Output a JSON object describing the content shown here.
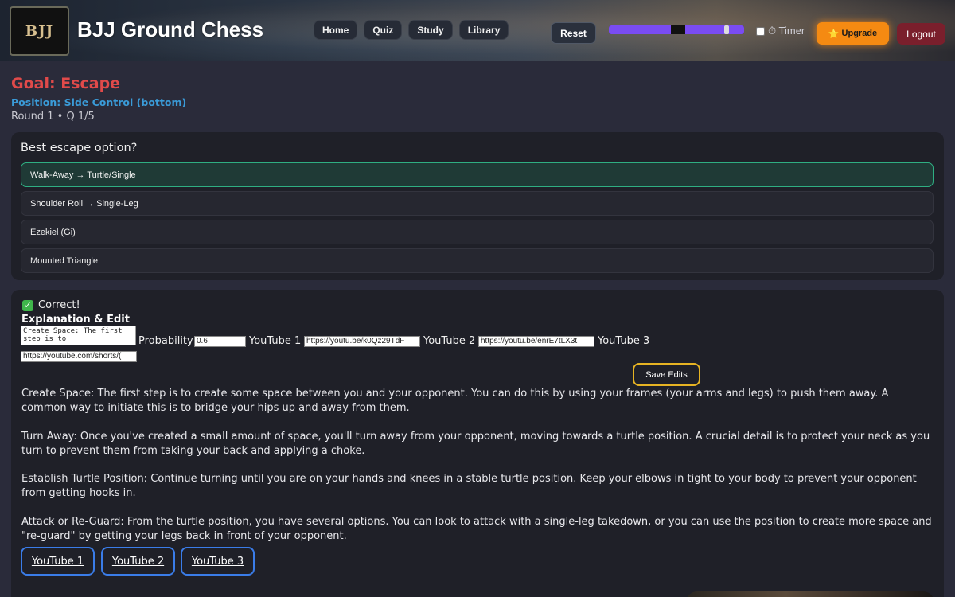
{
  "header": {
    "logo_text": "BJJ",
    "title": "BJJ Ground Chess",
    "nav": [
      "Home",
      "Quiz",
      "Study",
      "Library"
    ],
    "reset_label": "Reset",
    "progress": 0.8,
    "timer_label": "⏱ Timer",
    "timer_checked": false,
    "upgrade_label": "Upgrade",
    "upgrade_icon": "⭐",
    "logout_label": "Logout"
  },
  "quiz": {
    "goal": "Goal: Escape",
    "position": "Position: Side Control (bottom)",
    "round": "Round 1 • Q 1/5",
    "question": "Best escape option?",
    "options": [
      "Walk-Away → Turtle/Single",
      "Shoulder Roll → Single-Leg",
      "Ezekiel (Gi)",
      "Mounted Triangle"
    ],
    "selected_index": 0
  },
  "answer": {
    "status": "Correct!",
    "edit_title": "Explanation & Edit",
    "textarea_value": "Create Space: The first step is to",
    "probability_label": "Probability",
    "probability_value": "0.6",
    "yt1_label": "YouTube 1",
    "yt1_value": "https://youtu.be/k0Qz29TdF",
    "yt2_label": "YouTube 2",
    "yt2_value": "https://youtu.be/enrE7tLX3t",
    "yt3_label": "YouTube 3",
    "yt3_value": "https://youtube.com/shorts/(",
    "save_label": "Save Edits",
    "paragraphs": [
      "Create Space: The first step is to create some space between you and your opponent. You can do this by using your frames (your arms and legs) to push them away. A common way to initiate this is to bridge your hips up and away from them.",
      "Turn Away: Once you've created a small amount of space, you'll turn away from your opponent, moving towards a turtle position. A crucial detail is to protect your neck as you turn to prevent them from taking your back and applying a choke.",
      "Establish Turtle Position: Continue turning until you are on your hands and knees in a stable turtle position. Keep your elbows in tight to your body to prevent your opponent from getting hooks in.",
      "Attack or Re-Guard: From the turtle position, you have several options. You can look to attack with a single-leg takedown, or you can use the position to create more space and \"re-guard\" by getting your legs back in front of your opponent."
    ],
    "video_buttons": [
      "YouTube 1",
      "YouTube 2",
      "YouTube 3"
    ]
  }
}
